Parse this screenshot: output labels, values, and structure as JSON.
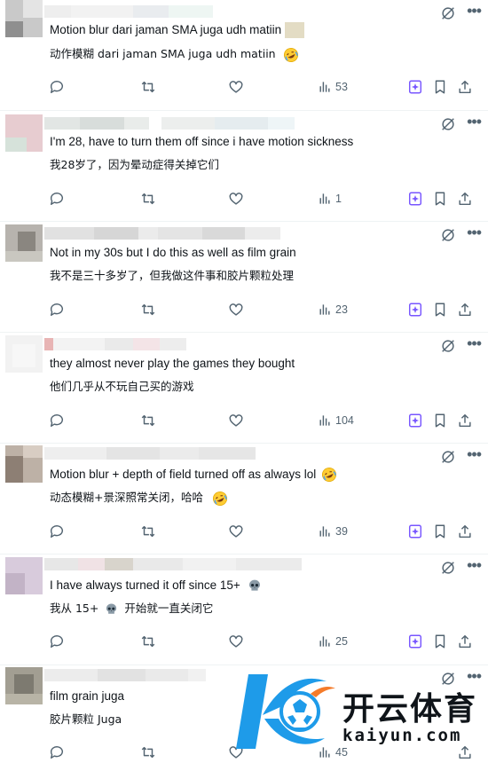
{
  "colors": {
    "icon": "#536471",
    "grok": "#7856ff",
    "watermark_blue": "#1e9be9",
    "watermark_orange": "#f47b2a"
  },
  "icons": {
    "reply": "reply-icon",
    "retweet": "retweet-icon",
    "like": "heart-icon",
    "views": "views-icon",
    "grok": "grok-icon",
    "bookmark": "bookmark-icon",
    "share": "share-icon",
    "translate": "translate-off-icon",
    "more": "more-icon"
  },
  "posts": [
    {
      "text": "Motion blur dari jaman SMA juga udh matiin",
      "translation": "动作模糊 dari jaman SMA juga udh matiin",
      "emoji_translation": "rofl",
      "views": "53"
    },
    {
      "text": "I'm 28, have to turn them off since i have motion sickness",
      "translation": "我28岁了，因为晕动症得关掉它们",
      "views": "1"
    },
    {
      "text": "Not in my 30s but I do this as well as film grain",
      "translation": "我不是三十多岁了，但我做这件事和胶片颗粒处理",
      "views": "23"
    },
    {
      "text": "they almost never play the games they bought",
      "translation": "他们几乎从不玩自己买的游戏",
      "views": "104"
    },
    {
      "text": "Motion blur + depth of field turned off as always lol",
      "translation": "动态模糊+景深照常关闭，哈哈",
      "emoji_text": "rofl",
      "emoji_translation": "rofl",
      "views": "39"
    },
    {
      "text": "I have always turned it off since 15+",
      "translation_a": "我从 15+",
      "translation_b": "开始就一直关闭它",
      "emoji_text": "skull",
      "emoji_translation": "skull",
      "views": "25"
    },
    {
      "text": "film grain juga",
      "translation": "胶片颗粒 Juga",
      "views": "45"
    }
  ],
  "watermark": {
    "brand": "开云体育",
    "domain": "kaiyun.com"
  }
}
